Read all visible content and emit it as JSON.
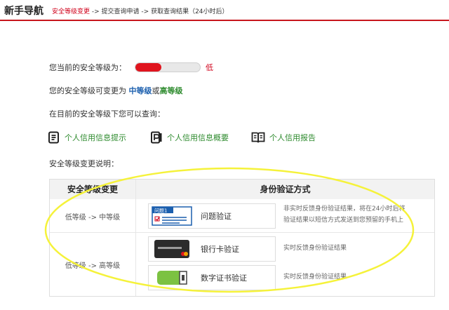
{
  "header": {
    "title": "新手导航",
    "steps": [
      "安全等级变更",
      "提交查询申请",
      "获取查询结果（24小时后）"
    ],
    "separator": " -> "
  },
  "security": {
    "current_label": "您当前的安全等级为：",
    "level_value": "低",
    "level_fill": 0.4,
    "change_prefix": "您的安全等级可变更为 ",
    "option_mid": "中等级",
    "or": "或",
    "option_high": "高等级",
    "query_label": "在目前的安全等级下您可以查询："
  },
  "links": [
    {
      "label": "个人信用信息提示",
      "icon": "document-lines-icon"
    },
    {
      "label": "个人信用信息概要",
      "icon": "document-p-icon"
    },
    {
      "label": "个人信用报告",
      "icon": "open-book-icon"
    }
  ],
  "explanation_label": "安全等级变更说明：",
  "table": {
    "headers": [
      "安全等级变更",
      "身份验证方式"
    ],
    "rows": [
      {
        "level": "低等级 -> 中等级",
        "methods": [
          {
            "label": "问题验证",
            "icon_text": "问题1",
            "desc": [
              "非实时反馈身份验证结果，将在24小时后将",
              "验证结果以短信方式发送到您预留的手机上"
            ]
          }
        ]
      },
      {
        "level": "低等级 -> 高等级",
        "methods": [
          {
            "label": "银行卡验证",
            "desc": [
              "实时反馈身份验证结果"
            ]
          },
          {
            "label": "数字证书验证",
            "desc": [
              "实时反馈身份验证结果"
            ]
          }
        ]
      }
    ]
  },
  "colors": {
    "accent_red": "#c8161d",
    "link_green": "#2e8b2e",
    "mid_blue": "#1b5fae",
    "highlight": "#f5f23a"
  }
}
